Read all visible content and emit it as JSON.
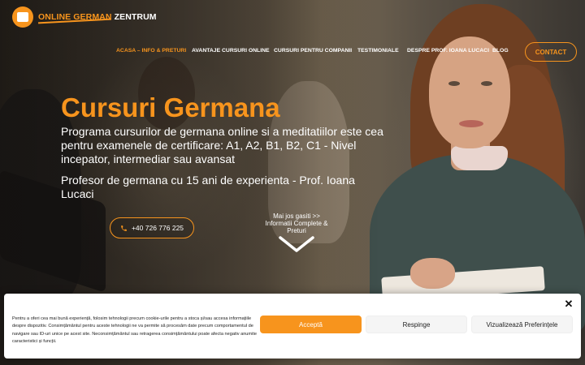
{
  "header": {
    "logo_text_prefix": "ONLINE GERMAN",
    "logo_text_highlight": "ZENTRUM",
    "nav": [
      {
        "label": "ACASA – INFO & PRETURI",
        "active": true
      },
      {
        "label": "AVANTAJE CURSURI ONLINE",
        "active": false
      },
      {
        "label": "CURSURI PENTRU COMPANII",
        "active": false
      },
      {
        "label": "TESTIMONIALE",
        "active": false
      },
      {
        "label": "DESPRE PROF. IOANA LUCACI",
        "active": false
      },
      {
        "label": "BLOG",
        "active": false
      }
    ],
    "contact_label": "CONTACT"
  },
  "hero": {
    "title": "Cursuri Germana",
    "description": "Programa cursurilor de germana online si a meditatiilor este cea pentru examenele de certificare: A1, A2, B1, B2, C1 - Nivel incepator, intermediar sau avansat",
    "description2": "Profesor de germana cu 15 ani de experienta - Prof. Ioana Lucaci",
    "phone_label": "+40 726 776 225",
    "scroll_line1": "Mai jos gasiti >>",
    "scroll_line2": "Informatii Complete &",
    "scroll_line3": "Preturi"
  },
  "cookie_banner": {
    "text": "Pentru a oferi cea mai bună experiență, folosim tehnologii precum cookie-urile pentru a stoca și/sau accesa informațiile despre dispozitiv. Consimțământul pentru aceste tehnologii ne va permite să procesăm date precum comportamentul de navigare sau ID-uri unice pe acest site. Neconsimțământul sau retragerea consimțământului poate afecta negativ anumite caracteristici și funcții.",
    "accept_label": "Acceptă",
    "deny_label": "Respinge",
    "prefs_label": "Vizualizează Preferințele",
    "close_glyph": "✕"
  },
  "colors": {
    "accent": "#f7941d",
    "text_light": "#ffffff",
    "banner_bg": "#ffffff"
  },
  "icons": [
    "logo-icon",
    "phone-icon",
    "chevron-down-icon",
    "close-icon"
  ]
}
